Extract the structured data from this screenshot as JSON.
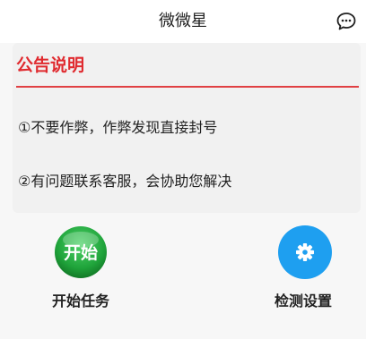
{
  "header": {
    "title": "微微星",
    "chat_icon": "chat-bubble-icon"
  },
  "notice": {
    "title": "公告说明",
    "lines": [
      "①不要作弊，作弊发现直接封号",
      "②有问题联系客服，会协助您解决"
    ]
  },
  "actions": {
    "start": {
      "icon_text": "开始",
      "label": "开始任务"
    },
    "check": {
      "icon": "gear-icon",
      "label": "检测设置"
    }
  },
  "colors": {
    "accent_red": "#e02a2f",
    "start_green": "#1fa33a",
    "check_blue": "#1e9ff0"
  }
}
